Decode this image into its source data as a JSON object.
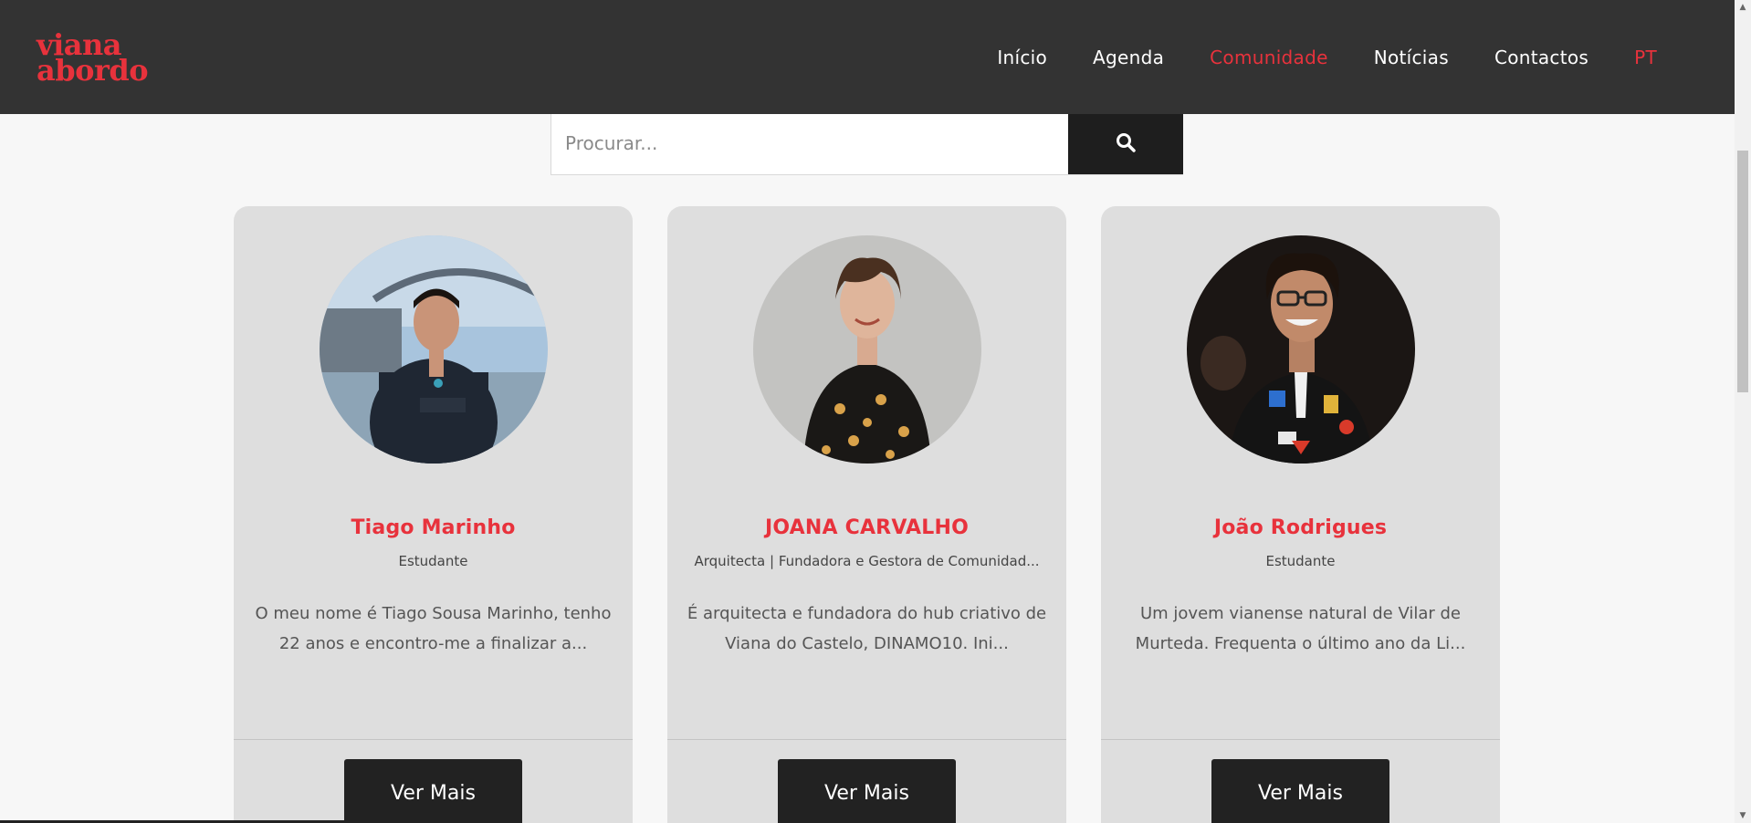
{
  "header": {
    "logo_line1": "viana",
    "logo_line2": "abordo",
    "nav": [
      {
        "label": "Início"
      },
      {
        "label": "Agenda"
      },
      {
        "label": "Comunidade"
      },
      {
        "label": "Notícias"
      },
      {
        "label": "Contactos"
      },
      {
        "label": "PT"
      }
    ]
  },
  "search": {
    "placeholder": "Procurar..."
  },
  "cards": [
    {
      "name": "Tiago Marinho",
      "role": "Estudante",
      "description": "O meu nome é Tiago Sousa Marinho, tenho 22 anos e encontro-me a finalizar a...",
      "button": "Ver Mais"
    },
    {
      "name": "JOANA CARVALHO",
      "role": "Arquitecta | Fundadora e Gestora de Comunidad...",
      "description": "É arquitecta e fundadora do hub criativo de Viana do Castelo, DINAMO10. Ini...",
      "button": "Ver Mais"
    },
    {
      "name": "João Rodrigues",
      "role": "Estudante",
      "description": "Um jovem vianense natural de Vilar de Murteda. Frequenta o último ano da Li...",
      "button": "Ver Mais"
    }
  ],
  "colors": {
    "accent": "#e8323c",
    "header_bg": "#333333",
    "card_bg": "#dedede",
    "button_bg": "#222222"
  }
}
